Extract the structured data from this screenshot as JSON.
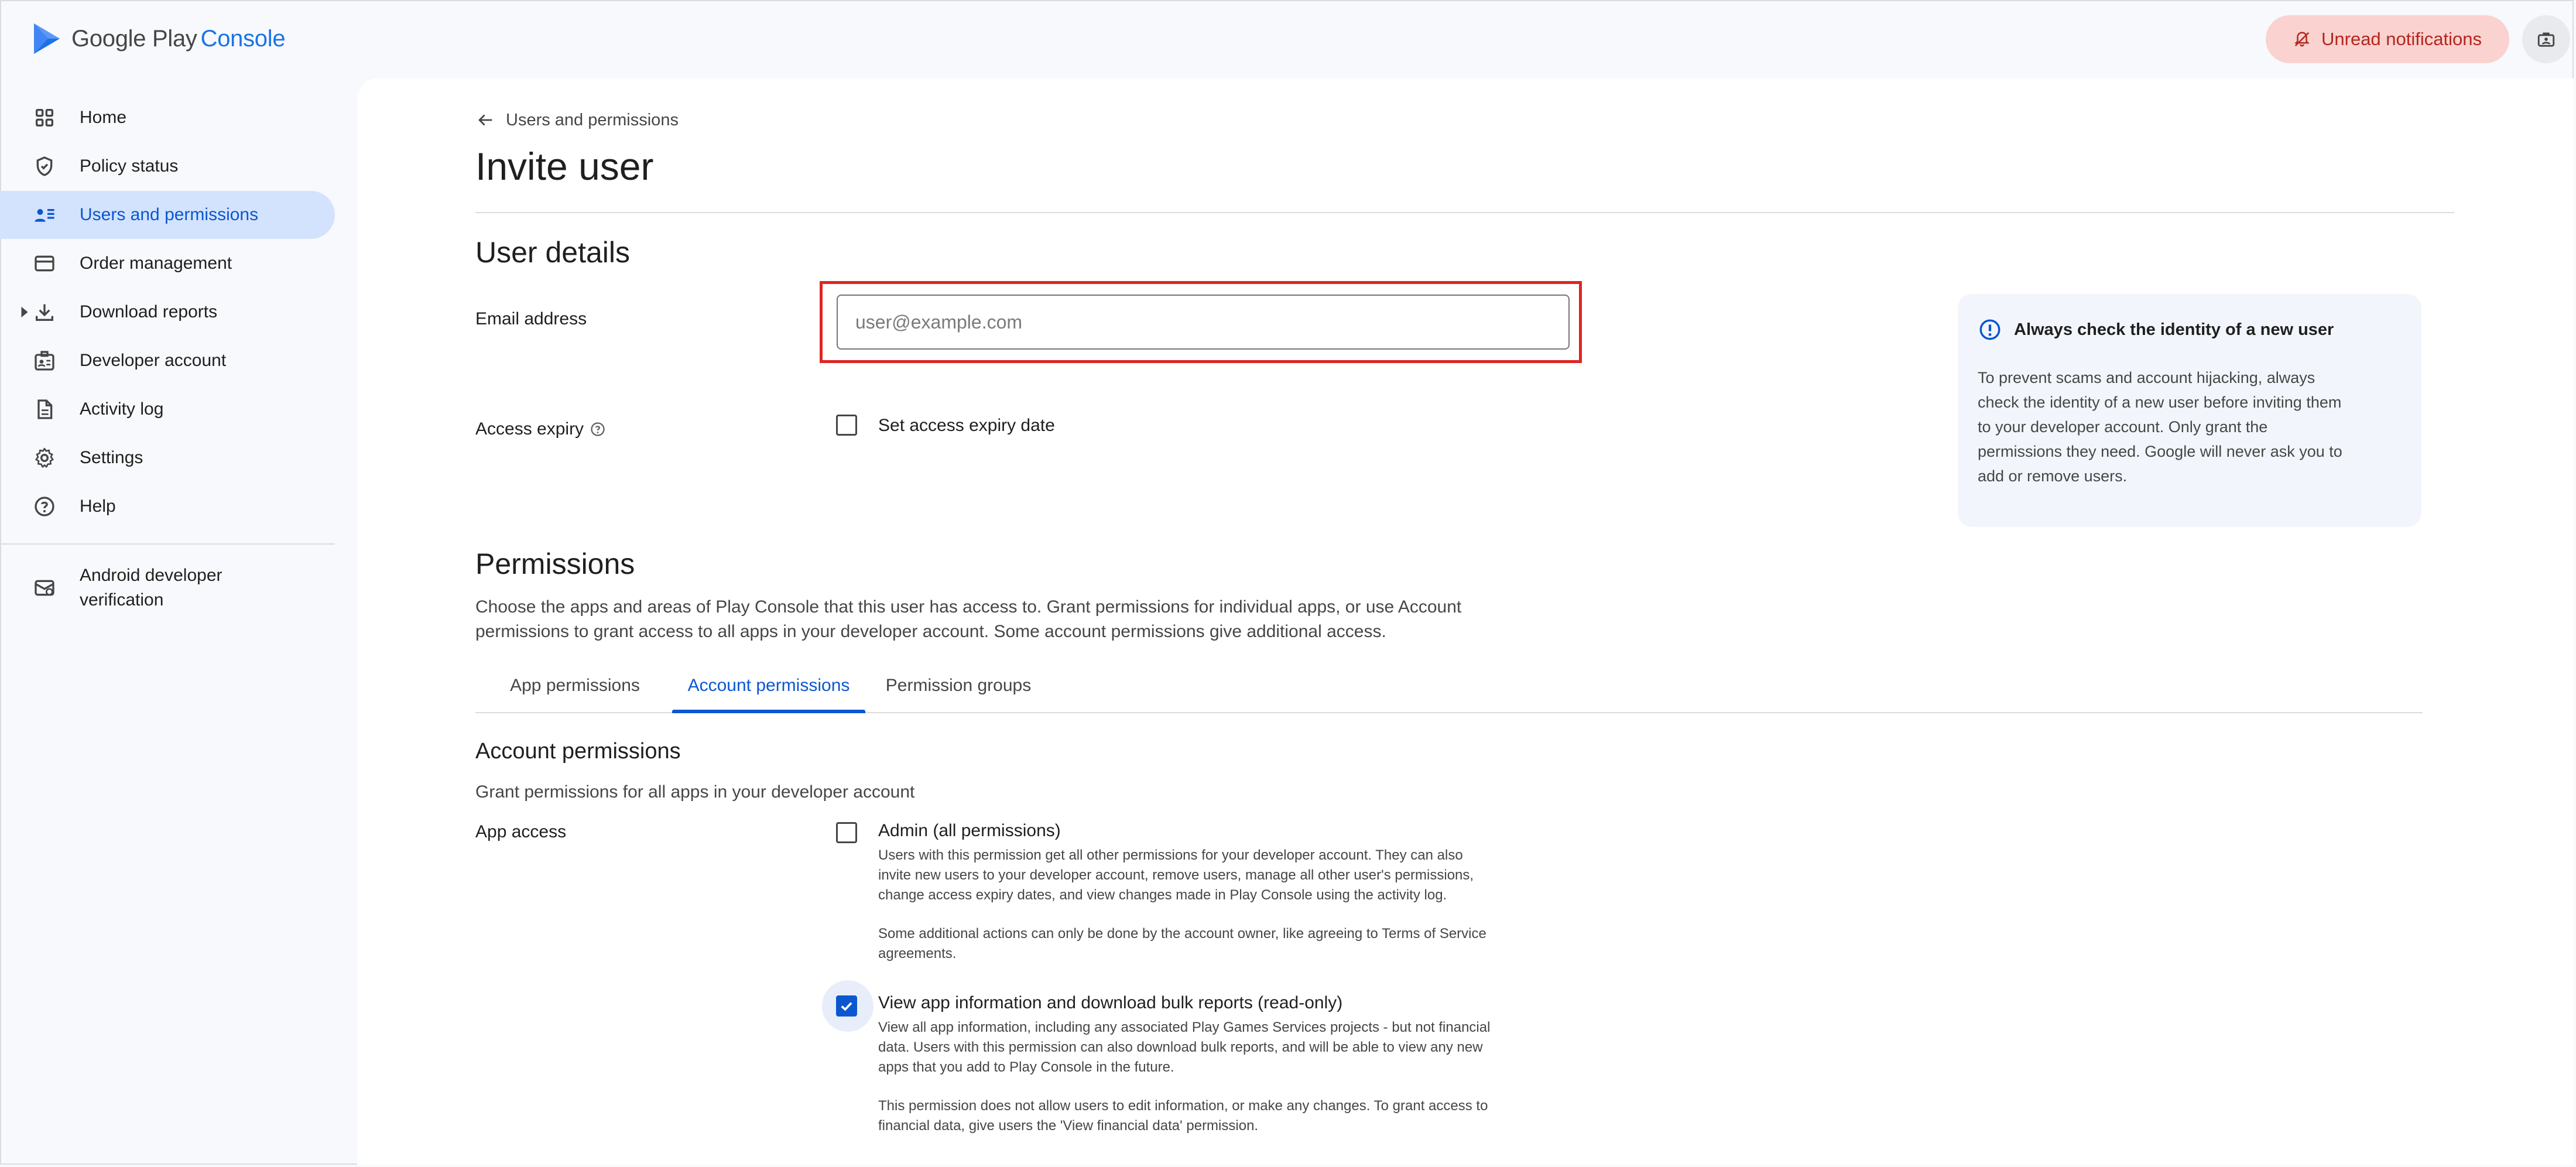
{
  "brand": {
    "name": "Google Play",
    "product": "Console",
    "accent": "#1a73e8"
  },
  "header": {
    "notifications_label": "Unread notifications",
    "notifications_color": "#b3261e"
  },
  "sidebar": {
    "items": [
      {
        "label": "Home",
        "icon": "grid-icon"
      },
      {
        "label": "Policy status",
        "icon": "shield-icon"
      },
      {
        "label": "Users and permissions",
        "icon": "users-icon",
        "active": true
      },
      {
        "label": "Order management",
        "icon": "credit-card-icon"
      },
      {
        "label": "Download reports",
        "icon": "download-icon"
      },
      {
        "label": "Developer account",
        "icon": "id-badge-icon"
      },
      {
        "label": "Activity log",
        "icon": "document-icon"
      },
      {
        "label": "Settings",
        "icon": "gear-icon"
      },
      {
        "label": "Help",
        "icon": "help-circle-icon"
      }
    ],
    "secondary": [
      {
        "label_line1": "Android developer",
        "label_line2": "verification",
        "icon": "verification-icon"
      }
    ]
  },
  "page": {
    "breadcrumb": "Users and permissions",
    "title": "Invite user"
  },
  "user_details": {
    "heading": "User details",
    "email_label": "Email address",
    "email_placeholder": "user@example.com",
    "email_value": "",
    "expiry_label": "Access expiry",
    "expiry_checkbox_label": "Set access expiry date",
    "expiry_checked": false
  },
  "info_card": {
    "title": "Always check the identity of a new user",
    "body_lines": [
      "To prevent scams and account hijacking, always",
      "check the identity of a new user before inviting them",
      "to your developer account. Only grant the",
      "permissions they need. Google will never ask you to",
      "add or remove users."
    ]
  },
  "permissions": {
    "heading": "Permissions",
    "desc_line1": "Choose the apps and areas of Play Console that this user has access to. Grant permissions for individual apps, or use Account",
    "desc_line2": "permissions to grant access to all apps in your developer account. Some account permissions give additional access.",
    "tabs": [
      {
        "label": "App permissions"
      },
      {
        "label": "Account permissions",
        "active": true
      },
      {
        "label": "Permission groups"
      }
    ]
  },
  "account_permissions": {
    "heading": "Account permissions",
    "subheading": "Grant permissions for all apps in your developer account",
    "group_label": "App access",
    "options": [
      {
        "title": "Admin (all permissions)",
        "checked": false,
        "desc_lines": [
          "Users with this permission get all other permissions for your developer account. They can also",
          "invite new users to your developer account, remove users, manage all other user's permissions,",
          "change access expiry dates, and view changes made in Play Console using the activity log."
        ],
        "note_lines": [
          "Some additional actions can only be done by the account owner, like agreeing to Terms of Service",
          "agreements."
        ]
      },
      {
        "title": "View app information and download bulk reports (read-only)",
        "checked": true,
        "desc_lines": [
          "View all app information, including any associated Play Games Services projects - but not financial",
          "data. Users with this permission can also download bulk reports, and will be able to view any new",
          "apps that you add to Play Console in the future."
        ],
        "note_lines": [
          "This permission does not allow users to edit information, or make any changes. To grant access to",
          "financial data, give users the 'View financial data' permission."
        ]
      }
    ]
  }
}
